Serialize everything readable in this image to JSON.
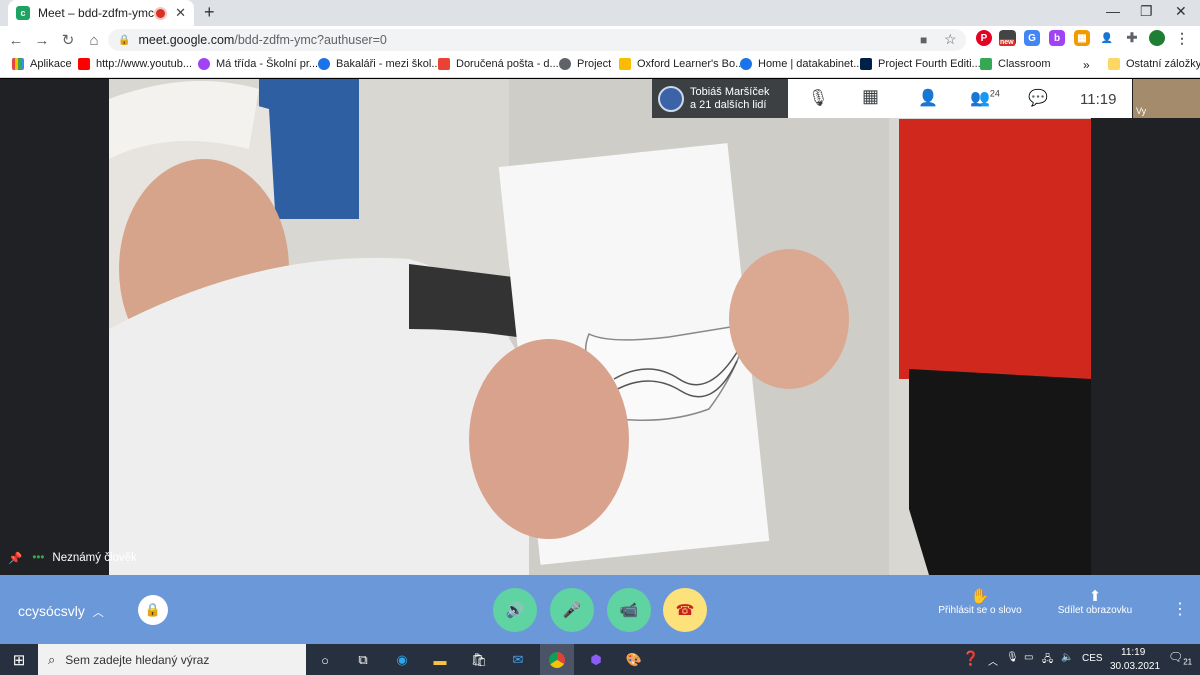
{
  "tab": {
    "title": "Meet – bdd-zdfm-ymc",
    "favicon_letter": "c"
  },
  "address": {
    "host": "meet.google.com",
    "path": "/bdd-zdfm-ymc?authuser=0"
  },
  "ext_new_badge": "new",
  "bookmarks": [
    {
      "label": "Aplikace",
      "color": "#e8453c"
    },
    {
      "label": "http://www.youtub...",
      "color": "#ff0000"
    },
    {
      "label": "Má třída - Školní pr...",
      "color": "#a142f4"
    },
    {
      "label": "Bakaláři - mezi škol...",
      "color": "#1a73e8"
    },
    {
      "label": "Doručená pošta - d...",
      "color": "#ea4335"
    },
    {
      "label": "Project",
      "color": "#5f6368"
    },
    {
      "label": "Oxford Learner's Bo...",
      "color": "#fbbc04"
    },
    {
      "label": "Home | datakabinet...",
      "color": "#1a73e8"
    },
    {
      "label": "Project Fourth Editi...",
      "color": "#002147"
    },
    {
      "label": "Classroom",
      "color": "#34a853"
    }
  ],
  "bookmarks_more": "»",
  "other_bookmarks": "Ostatní záložky",
  "meet": {
    "presenter_line1": "Tobiáš Maršíček",
    "presenter_line2": "a 21 dalších lidí",
    "participants_count": "24",
    "time": "11:19",
    "self_label": "Vy",
    "pinned_name": "Neznámý člověk",
    "meeting_code": "ccysócsvly",
    "raise_hand": "Přihlásit se o slovo",
    "present": "Sdílet obrazovku"
  },
  "taskbar": {
    "search_placeholder": "Sem zadejte hledaný výraz",
    "lang": "CES",
    "time": "11:19",
    "date": "30.03.2021",
    "notif_count": "21"
  }
}
